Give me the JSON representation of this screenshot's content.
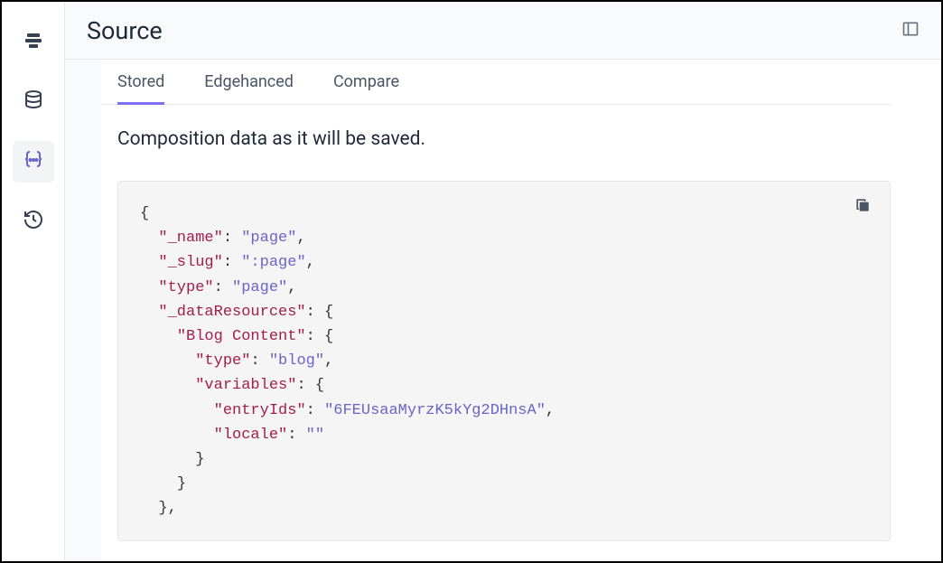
{
  "header": {
    "title": "Source"
  },
  "tabs": {
    "stored": "Stored",
    "edgehanced": "Edgehanced",
    "compare": "Compare"
  },
  "description": "Composition data as it will be saved.",
  "code": {
    "brace_open": "{",
    "brace_close": "}",
    "brace_close_comma": "},",
    "k_name": "\"_name\"",
    "v_name": "\"page\"",
    "k_slug": "\"_slug\"",
    "v_slug": "\":page\"",
    "k_type": "\"type\"",
    "v_type": "\"page\"",
    "k_dataResources": "\"_dataResources\"",
    "k_blogContent": "\"Blog Content\"",
    "k_type2": "\"type\"",
    "v_type2": "\"blog\"",
    "k_variables": "\"variables\"",
    "k_entryIds": "\"entryIds\"",
    "v_entryIds": "\"6FEUsaaMyrzK5kYg2DHnsA\"",
    "k_locale": "\"locale\"",
    "v_locale": "\"\"",
    "colon_space": ": ",
    "colon_brace": ": {",
    "comma": ","
  }
}
